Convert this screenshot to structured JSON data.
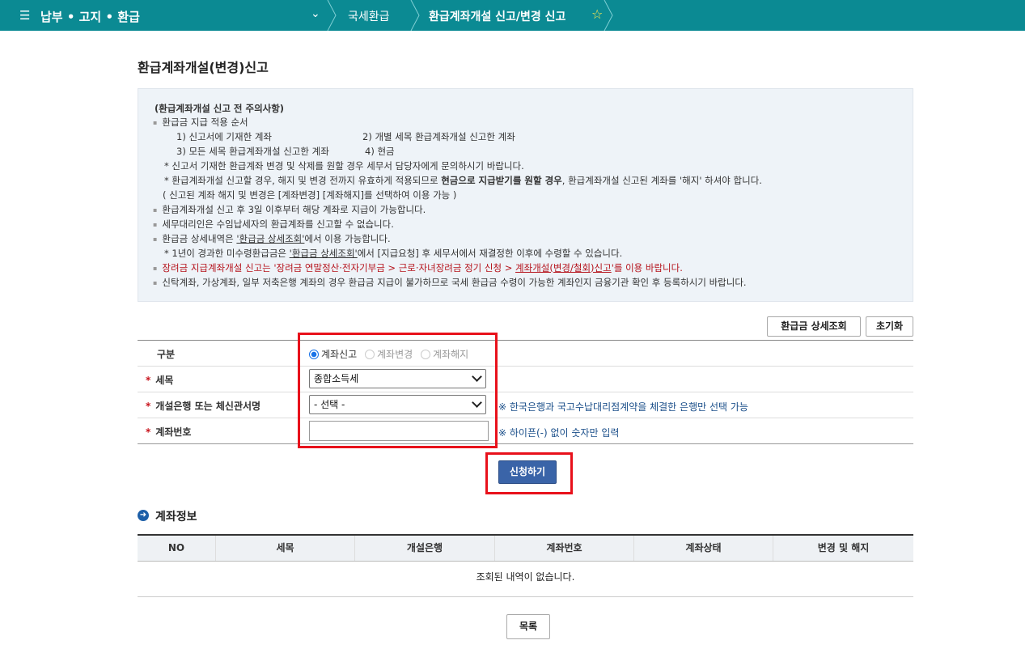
{
  "topbar": {
    "menu_title": "납부 • 고지 • 환급",
    "crumb1": "국세환급",
    "crumb2": "환급계좌개설 신고/변경 신고"
  },
  "page_title": "환급계좌개설(변경)신고",
  "notice": {
    "heading": "(환급계좌개설 신고 전 주의사항)",
    "l1": "환급금 지급 적용 순서",
    "l2a": "1) 신고서에 기재한 계좌",
    "l2b": "2) 개별 세목 환급계좌개설 신고한 계좌",
    "l3a": "3) 모든 세목 환급계좌개설 신고한 계좌",
    "l3b": "4) 현금",
    "l4": "* 신고서 기재한 환급계좌 변경 및 삭제를 원할 경우 세무서 담당자에게 문의하시기 바랍니다.",
    "l5a": "* 환급계좌개설 신고할 경우, 해지 및 변경 전까지 유효하게 적용되므로 ",
    "l5b": "현금으로 지급받기를 원할 경우",
    "l5c": ", 환급계좌개설 신고된 계좌를 '해지' 하셔야 합니다.",
    "l6": "( 신고된 계좌 해지 및 변경은 [계좌변경] [계좌해지]를 선택하여 이용 가능 )",
    "l7": "환급계좌개설 신고 후 3일 이후부터 해당 계좌로 지급이 가능합니다.",
    "l8": "세무대리인은 수임납세자의 환급계좌를 신고할 수 없습니다.",
    "l9a": "환급금 상세내역은 ",
    "l9b": "'환급금 상세조회'",
    "l9c": "에서 이용 가능합니다.",
    "l10a": "* 1년이 경과한 미수령환급금은 ",
    "l10b": "'환급금 상세조회'",
    "l10c": "에서 [지급요청] 후 세무서에서 재결정한 이후에 수령할 수 있습니다.",
    "l11a": "장려금 지급계좌개설 신고는 '장려금 연말정산·전자기부금 > 근로·자녀장려금 정기 신청 > ",
    "l11b": "계좌개설(변경/철회)신고",
    "l11c": "'를 이용 바랍니다.",
    "l12": "신탁계좌, 가상계좌, 일부 저축은행 계좌의 경우 환급금 지급이 불가하므로 국세 환급금 수령이 가능한 계좌인지 금융기관 확인 후 등록하시기 바랍니다."
  },
  "buttons": {
    "detail": "환급금 상세조회",
    "reset": "초기화",
    "submit": "신청하기",
    "list": "목록"
  },
  "form": {
    "label_type": "구분",
    "label_tax": "세목",
    "label_bank": "개설은행 또는 체신관서명",
    "label_account": "계좌번호",
    "required_mark": "*",
    "radio_new": "계좌신고",
    "radio_change": "계좌변경",
    "radio_cancel": "계좌해지",
    "tax_value": "종합소득세",
    "bank_value": "- 선택 -",
    "account_value": "",
    "bank_hint": "※ 한국은행과 국고수납대리점계약을 체결한 은행만 선택 가능",
    "account_hint": "※ 하이픈(-) 없이 숫자만 입력"
  },
  "account_section": {
    "title": "계좌정보",
    "columns": [
      "NO",
      "세목",
      "개설은행",
      "계좌번호",
      "계좌상태",
      "변경 및 해지"
    ],
    "empty_text": "조회된 내역이 없습니다."
  },
  "colors": {
    "topbar": "#0b8a93",
    "highlight": "#e8111b",
    "submit": "#3a64a8"
  }
}
